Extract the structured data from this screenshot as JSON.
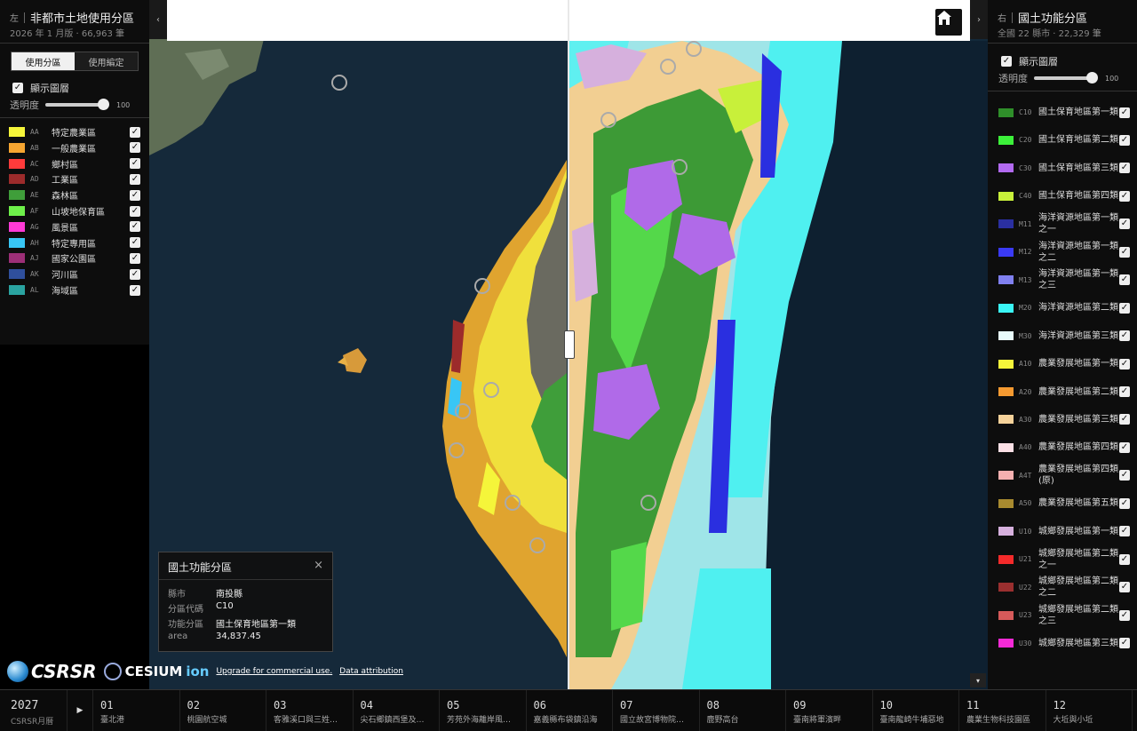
{
  "left": {
    "side": "左",
    "title": "非都市土地使用分區",
    "subtitle": "2026 年 1 月版 · 66,963 筆",
    "tabs": [
      "使用分區",
      "使用編定"
    ],
    "show_layer": "顯示圖層",
    "opacity_label": "透明度",
    "opacity_value": "100",
    "legend": [
      {
        "code": "AA",
        "name": "特定農業區",
        "color": "#f5f53a"
      },
      {
        "code": "AB",
        "name": "一般農業區",
        "color": "#f5a531"
      },
      {
        "code": "AC",
        "name": "鄉村區",
        "color": "#ff3b3b"
      },
      {
        "code": "AD",
        "name": "工業區",
        "color": "#9c2b2b"
      },
      {
        "code": "AE",
        "name": "森林區",
        "color": "#3f9e3a"
      },
      {
        "code": "AF",
        "name": "山坡地保育區",
        "color": "#6ef04a"
      },
      {
        "code": "AG",
        "name": "風景區",
        "color": "#ff3ad7"
      },
      {
        "code": "AH",
        "name": "特定專用區",
        "color": "#38c6f5"
      },
      {
        "code": "AJ",
        "name": "國家公園區",
        "color": "#9c2f77"
      },
      {
        "code": "AK",
        "name": "河川區",
        "color": "#2f4f9c"
      },
      {
        "code": "AL",
        "name": "海域區",
        "color": "#2aa3a0"
      }
    ]
  },
  "right": {
    "side": "右",
    "title": "國土功能分區",
    "subtitle": "全國 22 縣市 · 22,329 筆",
    "show_layer": "顯示圖層",
    "opacity_label": "透明度",
    "opacity_value": "100",
    "legend": [
      {
        "code": "C10",
        "name": "國土保育地區第一類",
        "color": "#2f8f2a"
      },
      {
        "code": "C20",
        "name": "國土保育地區第二類",
        "color": "#3cf03a"
      },
      {
        "code": "C30",
        "name": "國土保育地區第三類",
        "color": "#b26af0"
      },
      {
        "code": "C40",
        "name": "國土保育地區第四類",
        "color": "#c8f03a"
      },
      {
        "code": "M11",
        "name": "海洋資源地區第一類之一",
        "color": "#2a2fa0"
      },
      {
        "code": "M12",
        "name": "海洋資源地區第一類之二",
        "color": "#3a3af5"
      },
      {
        "code": "M13",
        "name": "海洋資源地區第一類之三",
        "color": "#8080f0"
      },
      {
        "code": "M20",
        "name": "海洋資源地區第二類",
        "color": "#3af5f5"
      },
      {
        "code": "M30",
        "name": "海洋資源地區第三類",
        "color": "#e8fbfb"
      },
      {
        "code": "A10",
        "name": "農業發展地區第一類",
        "color": "#f5f53a"
      },
      {
        "code": "A20",
        "name": "農業發展地區第二類",
        "color": "#f59a31"
      },
      {
        "code": "A30",
        "name": "農業發展地區第三類",
        "color": "#f5d29a"
      },
      {
        "code": "A40",
        "name": "農業發展地區第四類",
        "color": "#fbe0e6"
      },
      {
        "code": "A4T",
        "name": "農業發展地區第四類(原)",
        "color": "#f5b0b0"
      },
      {
        "code": "A50",
        "name": "農業發展地區第五類",
        "color": "#a88a2f"
      },
      {
        "code": "U10",
        "name": "城鄉發展地區第一類",
        "color": "#d6b0dd"
      },
      {
        "code": "U21",
        "name": "城鄉發展地區第二類之一",
        "color": "#f52a2a"
      },
      {
        "code": "U22",
        "name": "城鄉發展地區第二類之二",
        "color": "#9a2f2f"
      },
      {
        "code": "U23",
        "name": "城鄉發展地區第二類之三",
        "color": "#d65a5a"
      },
      {
        "code": "U30",
        "name": "城鄉發展地區第三類",
        "color": "#f52ad7"
      }
    ]
  },
  "popup": {
    "title": "國土功能分區",
    "close": "×",
    "rows": [
      {
        "k": "縣市",
        "v": "南投縣"
      },
      {
        "k": "分區代碼",
        "v": "C10"
      },
      {
        "k": "功能分區",
        "v": "國土保育地區第一類"
      },
      {
        "k": "area",
        "v": "34,837.45"
      }
    ]
  },
  "attribution": {
    "csrsr": "CSRSR",
    "cesium": "CESIUM",
    "ion": "ion",
    "upgrade": "Upgrade for commercial use.",
    "data": "Data attribution"
  },
  "timeline": {
    "year": "2027",
    "calendar": "CSRSR月曆",
    "months": [
      {
        "n": "01",
        "t": "臺北港"
      },
      {
        "n": "02",
        "t": "桃園航空城"
      },
      {
        "n": "03",
        "t": "客雅溪口與三姓…"
      },
      {
        "n": "04",
        "t": "尖石鄉鎮西堡及…"
      },
      {
        "n": "05",
        "t": "芳苑外海離岸風…"
      },
      {
        "n": "06",
        "t": "嘉義縣布袋鎮沿海"
      },
      {
        "n": "07",
        "t": "國立故宮博物院…"
      },
      {
        "n": "08",
        "t": "鹿野高台"
      },
      {
        "n": "09",
        "t": "臺南將軍濱畔"
      },
      {
        "n": "10",
        "t": "臺南龍崎牛埔惡地"
      },
      {
        "n": "11",
        "t": "農業生物科技園區"
      },
      {
        "n": "12",
        "t": "大坵與小坵"
      }
    ]
  }
}
